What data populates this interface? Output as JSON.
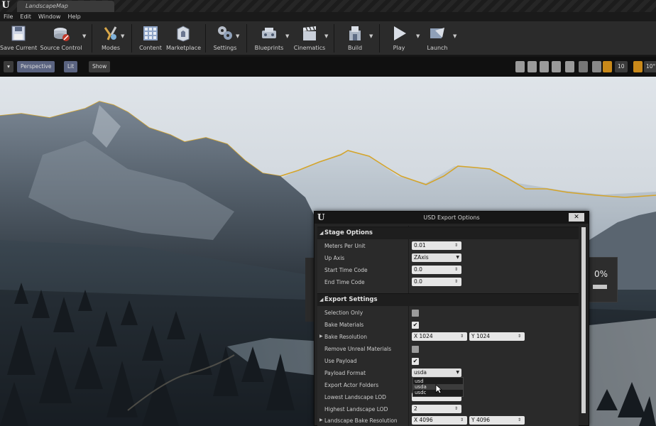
{
  "window": {
    "tab_title": "LandscapeMap"
  },
  "menu": [
    "File",
    "Edit",
    "Window",
    "Help"
  ],
  "toolbar": {
    "buttons": [
      {
        "label": "Save Current",
        "icon": "save-icon"
      },
      {
        "label": "Source Control",
        "icon": "source-control-icon"
      },
      {
        "label": "Modes",
        "icon": "modes-icon"
      },
      {
        "label": "Content",
        "icon": "content-icon"
      },
      {
        "label": "Marketplace",
        "icon": "marketplace-icon"
      },
      {
        "label": "Settings",
        "icon": "settings-icon"
      },
      {
        "label": "Blueprints",
        "icon": "blueprints-icon"
      },
      {
        "label": "Cinematics",
        "icon": "cinematics-icon"
      },
      {
        "label": "Build",
        "icon": "build-icon"
      },
      {
        "label": "Play",
        "icon": "play-icon"
      },
      {
        "label": "Launch",
        "icon": "launch-icon"
      }
    ]
  },
  "viewport_bar": {
    "perspective": "Perspective",
    "lit": "Lit",
    "show": "Show",
    "grid_snap": "10",
    "rot_snap": "10°"
  },
  "progress": {
    "percent_text": "0%",
    "value": 0
  },
  "dialog": {
    "title": "USD Export Options",
    "close": "✕",
    "stage_options": {
      "header": "Stage Options",
      "meters_per_unit": {
        "label": "Meters Per Unit",
        "value": "0.01"
      },
      "up_axis": {
        "label": "Up Axis",
        "value": "ZAxis"
      },
      "start_time_code": {
        "label": "Start Time Code",
        "value": "0.0"
      },
      "end_time_code": {
        "label": "End Time Code",
        "value": "0.0"
      }
    },
    "export_settings": {
      "header": "Export Settings",
      "selection_only": {
        "label": "Selection Only",
        "checked": false
      },
      "bake_materials": {
        "label": "Bake Materials",
        "checked": true
      },
      "bake_resolution": {
        "label": "Bake Resolution",
        "x_label": "X",
        "x": "1024",
        "y_label": "Y",
        "y": "1024"
      },
      "remove_unreal_materials": {
        "label": "Remove Unreal Materials",
        "checked": false
      },
      "use_payload": {
        "label": "Use Payload",
        "checked": true
      },
      "payload_format": {
        "label": "Payload Format",
        "value": "usda",
        "options": [
          "usd",
          "usda",
          "usdc"
        ],
        "highlighted": "usda"
      },
      "export_actor_folders": {
        "label": "Export Actor Folders"
      },
      "lowest_landscape_lod": {
        "label": "Lowest Landscape LOD"
      },
      "highest_landscape_lod": {
        "label": "Highest Landscape LOD",
        "value": "2"
      },
      "landscape_bake_resolution": {
        "label": "Landscape Bake Resolution",
        "x_label": "X",
        "x": "4096",
        "y_label": "Y",
        "y": "4096"
      }
    }
  },
  "colors": {
    "ridge_outline": "#d4a42a",
    "dialog_bg": "#242424",
    "toolbar_bg": "#2b2b2b"
  }
}
